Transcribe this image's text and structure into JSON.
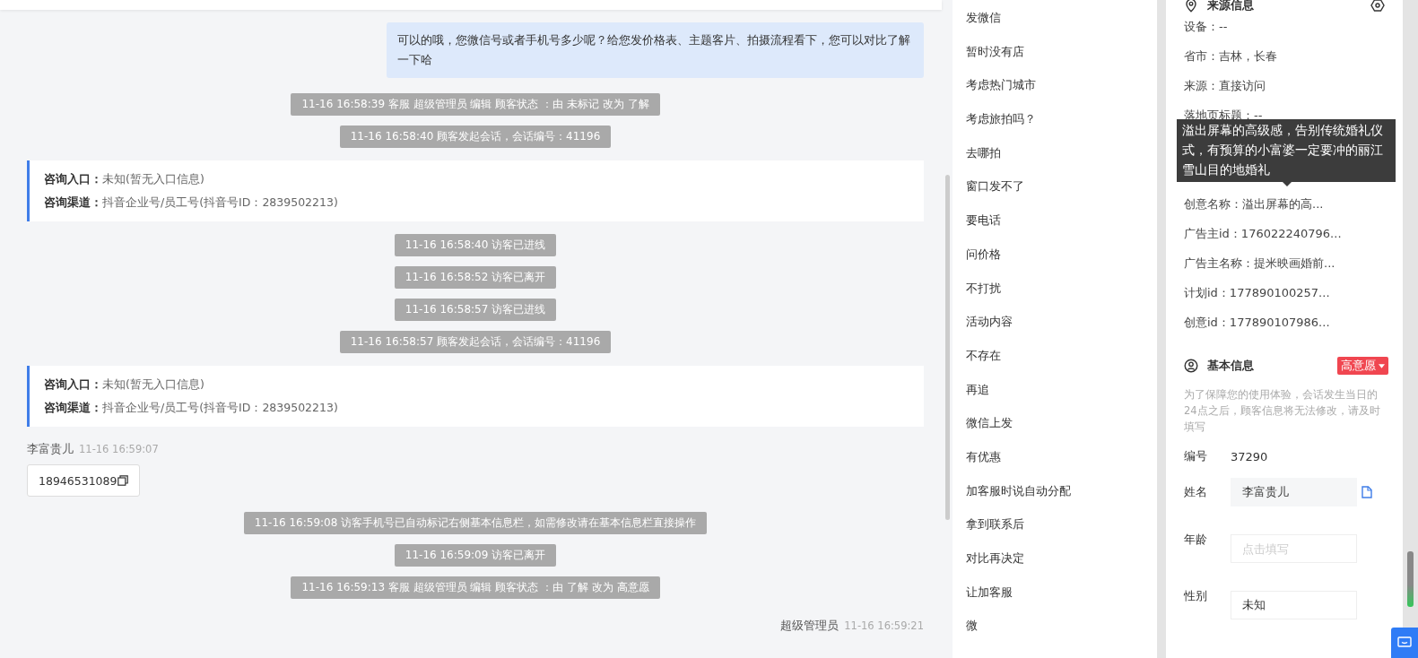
{
  "chat": {
    "messages": [
      {
        "kind": "outgoing",
        "text": "可以的哦，您微信号或者手机号多少呢？给您发价格表、主题客片、拍摄流程看下，您可以对比了解一下哈"
      },
      {
        "kind": "system",
        "text": "11-16 16:58:39 客服 超级管理员 编辑 顾客状态 ：由 未标记 改为 了解"
      },
      {
        "kind": "system",
        "text": "11-16 16:58:40 顾客发起会话，会话编号：41196"
      },
      {
        "kind": "info",
        "lines": [
          {
            "label": "咨询入口：",
            "value": "未知(暂无入口信息)"
          },
          {
            "label": "咨询渠道：",
            "value": "抖音企业号/员工号(抖音号ID：2839502213)"
          }
        ]
      },
      {
        "kind": "system",
        "text": "11-16 16:58:40 访客已进线"
      },
      {
        "kind": "system",
        "text": "11-16 16:58:52 访客已离开"
      },
      {
        "kind": "system",
        "text": "11-16 16:58:57 访客已进线"
      },
      {
        "kind": "system",
        "text": "11-16 16:58:57 顾客发起会话，会话编号：41196"
      },
      {
        "kind": "info",
        "lines": [
          {
            "label": "咨询入口：",
            "value": "未知(暂无入口信息)"
          },
          {
            "label": "咨询渠道：",
            "value": "抖音企业号/员工号(抖音号ID：2839502213)"
          }
        ]
      },
      {
        "kind": "incoming",
        "sender": "李富贵儿",
        "time": "11-16 16:59:07",
        "text": "18946531089"
      },
      {
        "kind": "system",
        "text": "11-16 16:59:08 访客手机号已自动标记右侧基本信息栏，如需修改请在基本信息栏直接操作"
      },
      {
        "kind": "system",
        "text": "11-16 16:59:09 访客已离开"
      },
      {
        "kind": "system",
        "text": "11-16 16:59:13 客服 超级管理员 编辑 顾客状态 ：由 了解 改为 高意愿"
      },
      {
        "kind": "sender",
        "sender": "超级管理员",
        "time": "11-16 16:59:21"
      }
    ]
  },
  "quick_replies": [
    "发微信",
    "暂时没有店",
    "考虑热门城市",
    "考虑旅拍吗？",
    "去哪拍",
    "窗口发不了",
    "要电话",
    "问价格",
    "不打扰",
    "活动内容",
    "不存在",
    "再追",
    "微信上发",
    "有优惠",
    "加客服时说自动分配",
    "拿到联系后",
    "对比再决定",
    "让加客服",
    "微"
  ],
  "source_info": {
    "title": "来源信息",
    "rows_top": [
      "设备：--",
      "省市：吉林，长春",
      "来源：直接访问",
      "落地页标题：--"
    ],
    "tooltip": "溢出屏幕的高级感，告别传统婚礼仪式，有预算的小富婆一定要冲的丽江雪山目的地婚礼",
    "rows_bottom": [
      "创意名称：溢出屏幕的高...",
      "广告主id：176022240796...",
      "广告主名称：提米映画婚前...",
      "计划id：177890100257...",
      "创意id：177890107986..."
    ]
  },
  "basic_info": {
    "title": "基本信息",
    "tag": "高意愿",
    "note": "为了保障您的使用体验，会话发生当日的24点之后，顾客信息将无法修改，请及时填写",
    "fields": [
      {
        "kind": "text",
        "label": "编号",
        "value": "37290"
      },
      {
        "kind": "input",
        "label": "姓名",
        "value": "李富贵儿"
      },
      {
        "kind": "input",
        "label": "年龄",
        "placeholder": "点击填写"
      },
      {
        "kind": "input",
        "label": "性别",
        "value": "未知"
      }
    ]
  }
}
